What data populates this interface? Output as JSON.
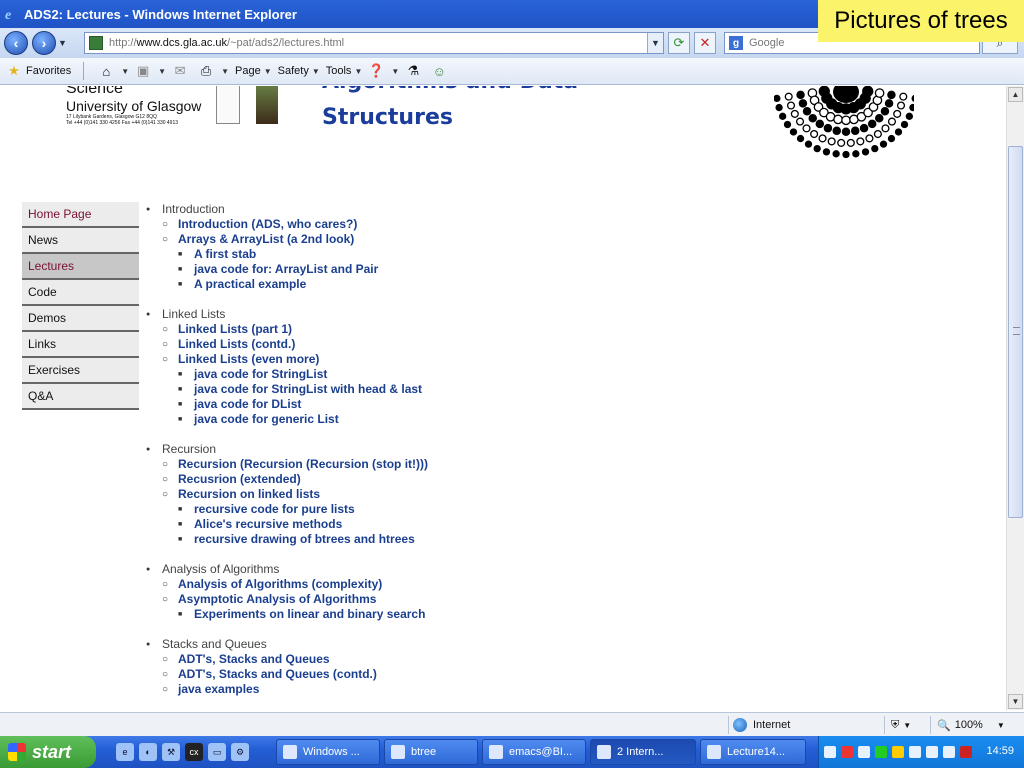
{
  "window": {
    "title": "ADS2: Lectures - Windows Internet Explorer"
  },
  "overlay_note": "Pictures of trees",
  "address": {
    "prefix": "http://",
    "domain": "www.dcs.gla.ac.uk",
    "path": "/~pat/ads2/lectures.html"
  },
  "search": {
    "placeholder": "Google"
  },
  "commandbar": {
    "favorites": "Favorites",
    "page": "Page",
    "safety": "Safety",
    "tools": "Tools"
  },
  "header": {
    "science": "Science",
    "university": "University of Glasgow",
    "address_line1": "17 Lilybank Gardens, Glasgow G12 8QQ",
    "address_line2": "Tel +44 (0)141 330 4256  Fax +44 (0)141 330 4913",
    "title_line1": "Algorithms and Data",
    "title_line2": "Structures"
  },
  "sidenav": [
    {
      "label": "Home Page",
      "state": "home"
    },
    {
      "label": "News",
      "state": ""
    },
    {
      "label": "Lectures",
      "state": "active"
    },
    {
      "label": "Code",
      "state": ""
    },
    {
      "label": "Demos",
      "state": ""
    },
    {
      "label": "Links",
      "state": ""
    },
    {
      "label": "Exercises",
      "state": ""
    },
    {
      "label": "Q&A",
      "state": ""
    }
  ],
  "sections": [
    {
      "title": "Introduction",
      "items": [
        {
          "label": "Introduction (ADS, who cares?)",
          "sub": []
        },
        {
          "label": "Arrays & ArrayList (a 2nd look)",
          "sub": [
            "A first stab",
            "java code for: ArrayList and Pair",
            "A practical example"
          ]
        }
      ]
    },
    {
      "title": "Linked Lists",
      "items": [
        {
          "label": "Linked Lists (part 1)",
          "sub": []
        },
        {
          "label": "Linked Lists (contd.)",
          "sub": []
        },
        {
          "label": "Linked Lists (even more)",
          "sub": [
            "java code for StringList",
            "java code for StringList with head & last",
            "java code for DList",
            "java code for generic List"
          ]
        }
      ]
    },
    {
      "title": "Recursion",
      "items": [
        {
          "label": "Recursion (Recursion (Recursion (stop it!)))",
          "sub": []
        },
        {
          "label": "Recusrion (extended)",
          "sub": []
        },
        {
          "label": "Recursion on linked lists",
          "sub": [
            "recursive code for pure lists",
            "Alice's recursive methods",
            "recursive drawing of btrees and htrees"
          ]
        }
      ]
    },
    {
      "title": "Analysis of Algorithms",
      "items": [
        {
          "label": "Analysis of Algorithms (complexity)",
          "sub": []
        },
        {
          "label": "Asymptotic Analysis of Algorithms",
          "sub": [
            "Experiments on linear and binary search"
          ]
        }
      ]
    },
    {
      "title": "Stacks and Queues",
      "items": [
        {
          "label": "ADT's, Stacks and Queues",
          "sub": []
        },
        {
          "label": "ADT's, Stacks and Queues (contd.)",
          "sub": []
        },
        {
          "label": "java examples",
          "sub": []
        }
      ]
    }
  ],
  "statusbar": {
    "zone": "Internet",
    "zoom": "100%"
  },
  "taskbar": {
    "start": "start",
    "tasks": [
      {
        "label": "Windows ...",
        "active": false
      },
      {
        "label": "btree",
        "active": false
      },
      {
        "label": "emacs@BI...",
        "active": false
      },
      {
        "label": "2 Intern...",
        "active": true
      },
      {
        "label": "Lecture14...",
        "active": false
      }
    ],
    "clock": "14:59"
  }
}
